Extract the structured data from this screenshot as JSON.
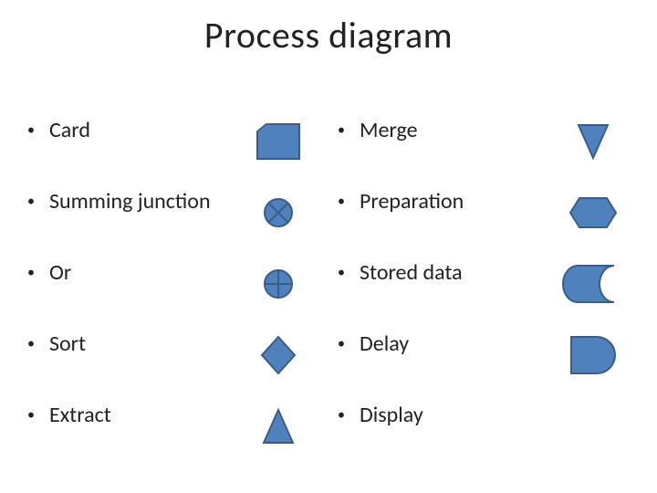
{
  "title": "Process diagram",
  "rows": [
    {
      "left_label": "Card",
      "left_icon": "card-icon",
      "right_label": "Merge",
      "right_icon": "merge-icon"
    },
    {
      "left_label": "Summing junction",
      "left_icon": "summing-junction-icon",
      "right_label": "Preparation",
      "right_icon": "preparation-icon"
    },
    {
      "left_label": "Or",
      "left_icon": "or-icon",
      "right_label": "Stored data",
      "right_icon": "stored-data-icon"
    },
    {
      "left_label": "Sort",
      "left_icon": "sort-icon",
      "right_label": "Delay",
      "right_icon": "delay-icon"
    },
    {
      "left_label": "Extract",
      "left_icon": "extract-icon",
      "right_label": "Display",
      "right_icon": ""
    }
  ],
  "colors": {
    "fill": "#4f81bd",
    "stroke": "#385d8a"
  },
  "row_top_start": 130,
  "row_spacing": 78
}
